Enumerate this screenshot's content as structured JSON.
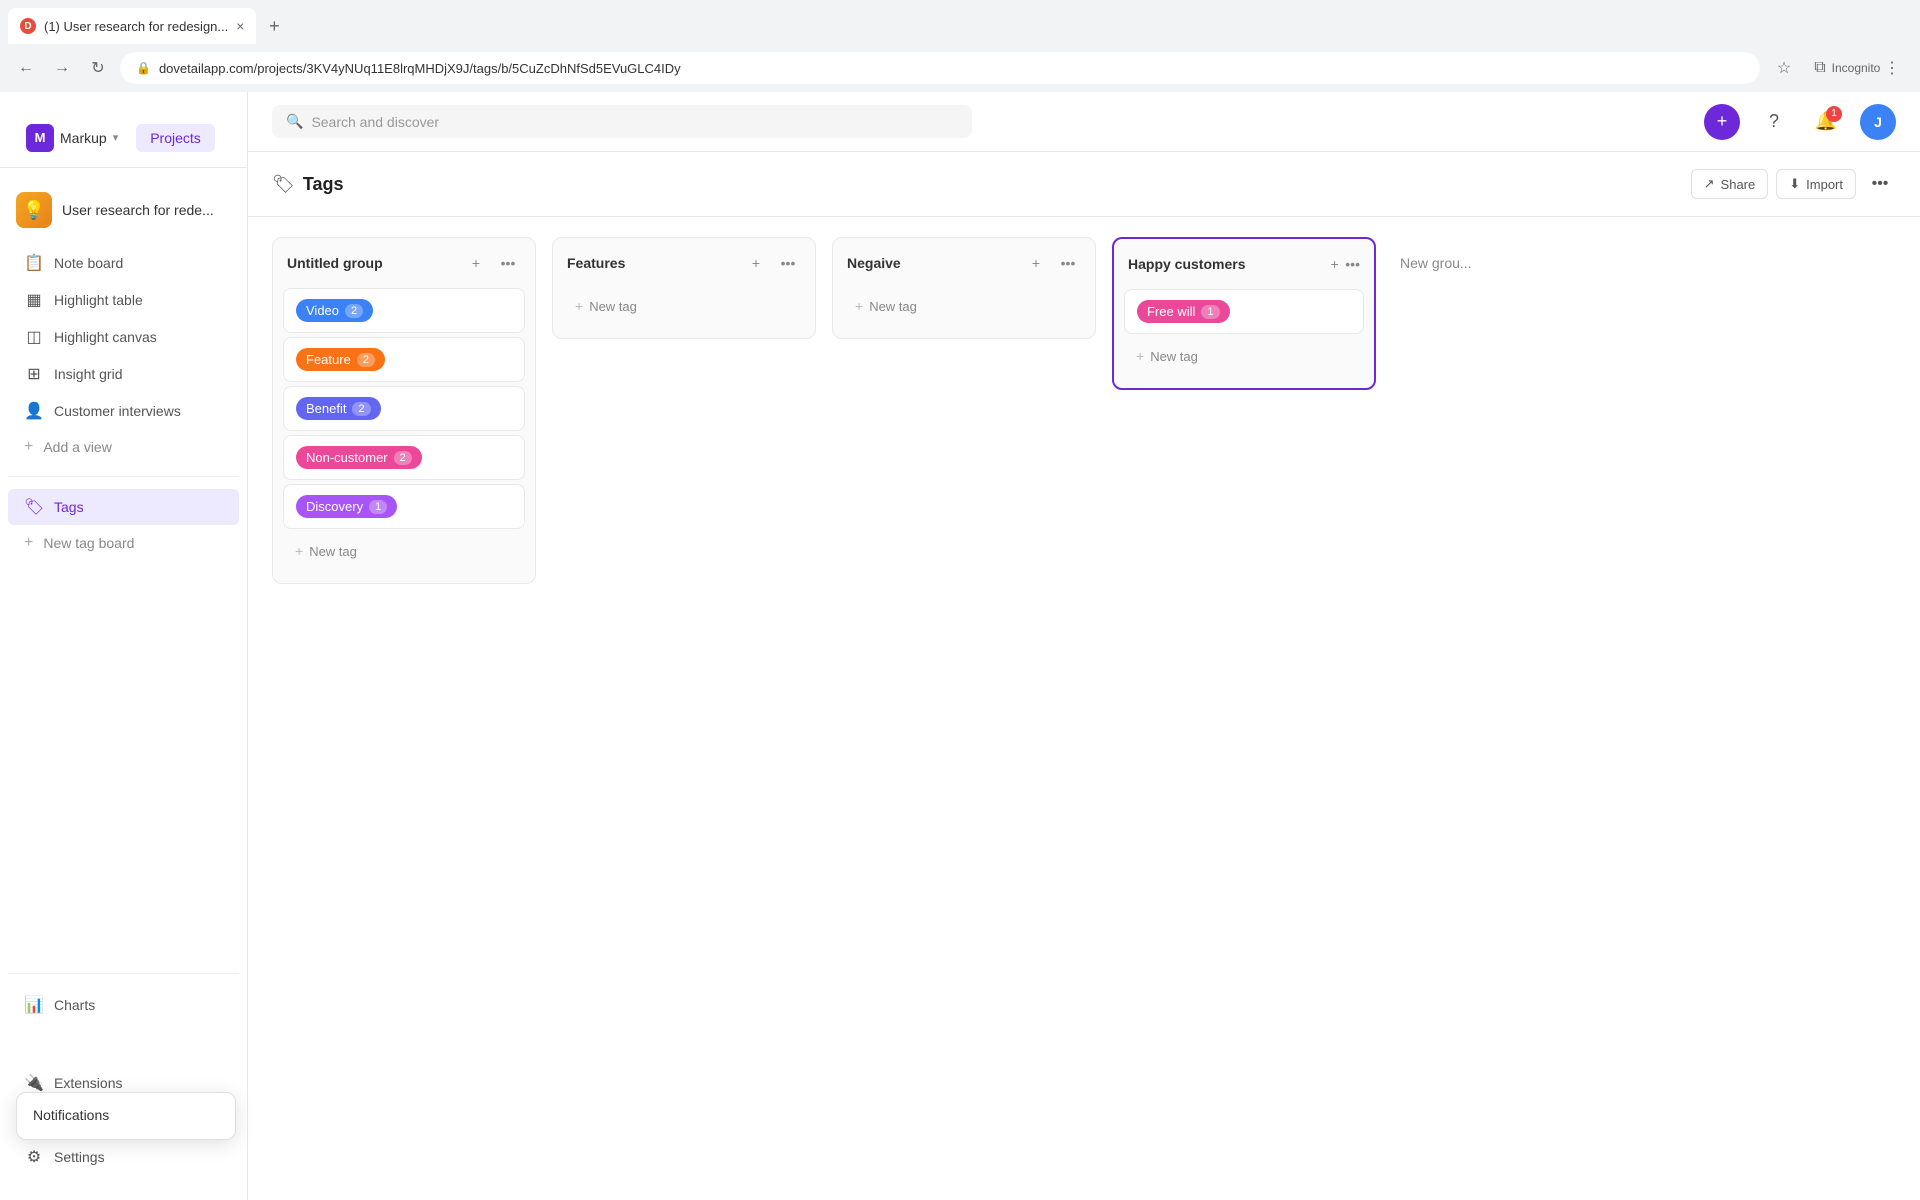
{
  "browser": {
    "tab_title": "(1) User research for redesign...",
    "tab_close": "×",
    "tab_new": "+",
    "url": "dovetailapp.com/projects/3KV4yNUq11E8lrqMHDjX9J/tags/b/5CuZcDhNfSd5EVuGLC4IDy",
    "nav_back": "←",
    "nav_forward": "→",
    "nav_refresh": "↻",
    "more": "⋮",
    "bookmark": "☆",
    "extensions": "⧉",
    "profile": "Incognito"
  },
  "topbar": {
    "workspace_initial": "M",
    "workspace_name": "Markup",
    "workspace_arrow": "▾",
    "projects_label": "Projects",
    "search_placeholder": "Search and discover",
    "add_icon": "+",
    "help_icon": "?",
    "notif_count": "1",
    "avatar_initial": "J"
  },
  "sidebar": {
    "project_name": "User research for rede...",
    "items": [
      {
        "id": "note-board",
        "label": "Note board",
        "icon": "📋"
      },
      {
        "id": "highlight-table",
        "label": "Highlight table",
        "icon": "▦"
      },
      {
        "id": "highlight-canvas",
        "label": "Highlight canvas",
        "icon": "◫"
      },
      {
        "id": "insight-grid",
        "label": "Insight grid",
        "icon": "⊞"
      },
      {
        "id": "customer-interviews",
        "label": "Customer interviews",
        "icon": "👤"
      }
    ],
    "add_view_label": "Add a view",
    "tags_label": "Tags",
    "new_tag_board_label": "New tag board",
    "bottom_items": [
      {
        "id": "extensions",
        "label": "Extensions",
        "icon": "🔌"
      },
      {
        "id": "notifications",
        "label": "Notifications",
        "icon": "🔔",
        "has_arrow": true
      },
      {
        "id": "settings",
        "label": "Settings",
        "icon": "⚙"
      }
    ],
    "notifications_tooltip": "Notifications"
  },
  "main": {
    "page_title": "Tags",
    "page_icon": "🏷",
    "share_label": "Share",
    "import_label": "Import"
  },
  "board": {
    "columns": [
      {
        "id": "untitled-group",
        "title": "Untitled group",
        "tags": [
          {
            "label": "Video",
            "count": 2,
            "color": "tag-blue"
          },
          {
            "label": "Feature",
            "count": 2,
            "color": "tag-orange"
          },
          {
            "label": "Benefit",
            "count": 2,
            "color": "tag-indigo"
          },
          {
            "label": "Non-customer",
            "count": 2,
            "color": "tag-pink"
          },
          {
            "label": "Discovery",
            "count": 1,
            "color": "tag-purple"
          }
        ],
        "new_tag_label": "New tag"
      },
      {
        "id": "features",
        "title": "Features",
        "tags": [],
        "new_tag_label": "New tag"
      },
      {
        "id": "negaive",
        "title": "Negaive",
        "tags": [],
        "new_tag_label": "New tag"
      },
      {
        "id": "happy-customers",
        "title": "Happy customers",
        "highlighted": true,
        "tags": [
          {
            "label": "Free will",
            "count": 1,
            "color": "tag-pink"
          }
        ],
        "new_tag_label": "New tag"
      }
    ],
    "new_group_label": "New grou..."
  }
}
